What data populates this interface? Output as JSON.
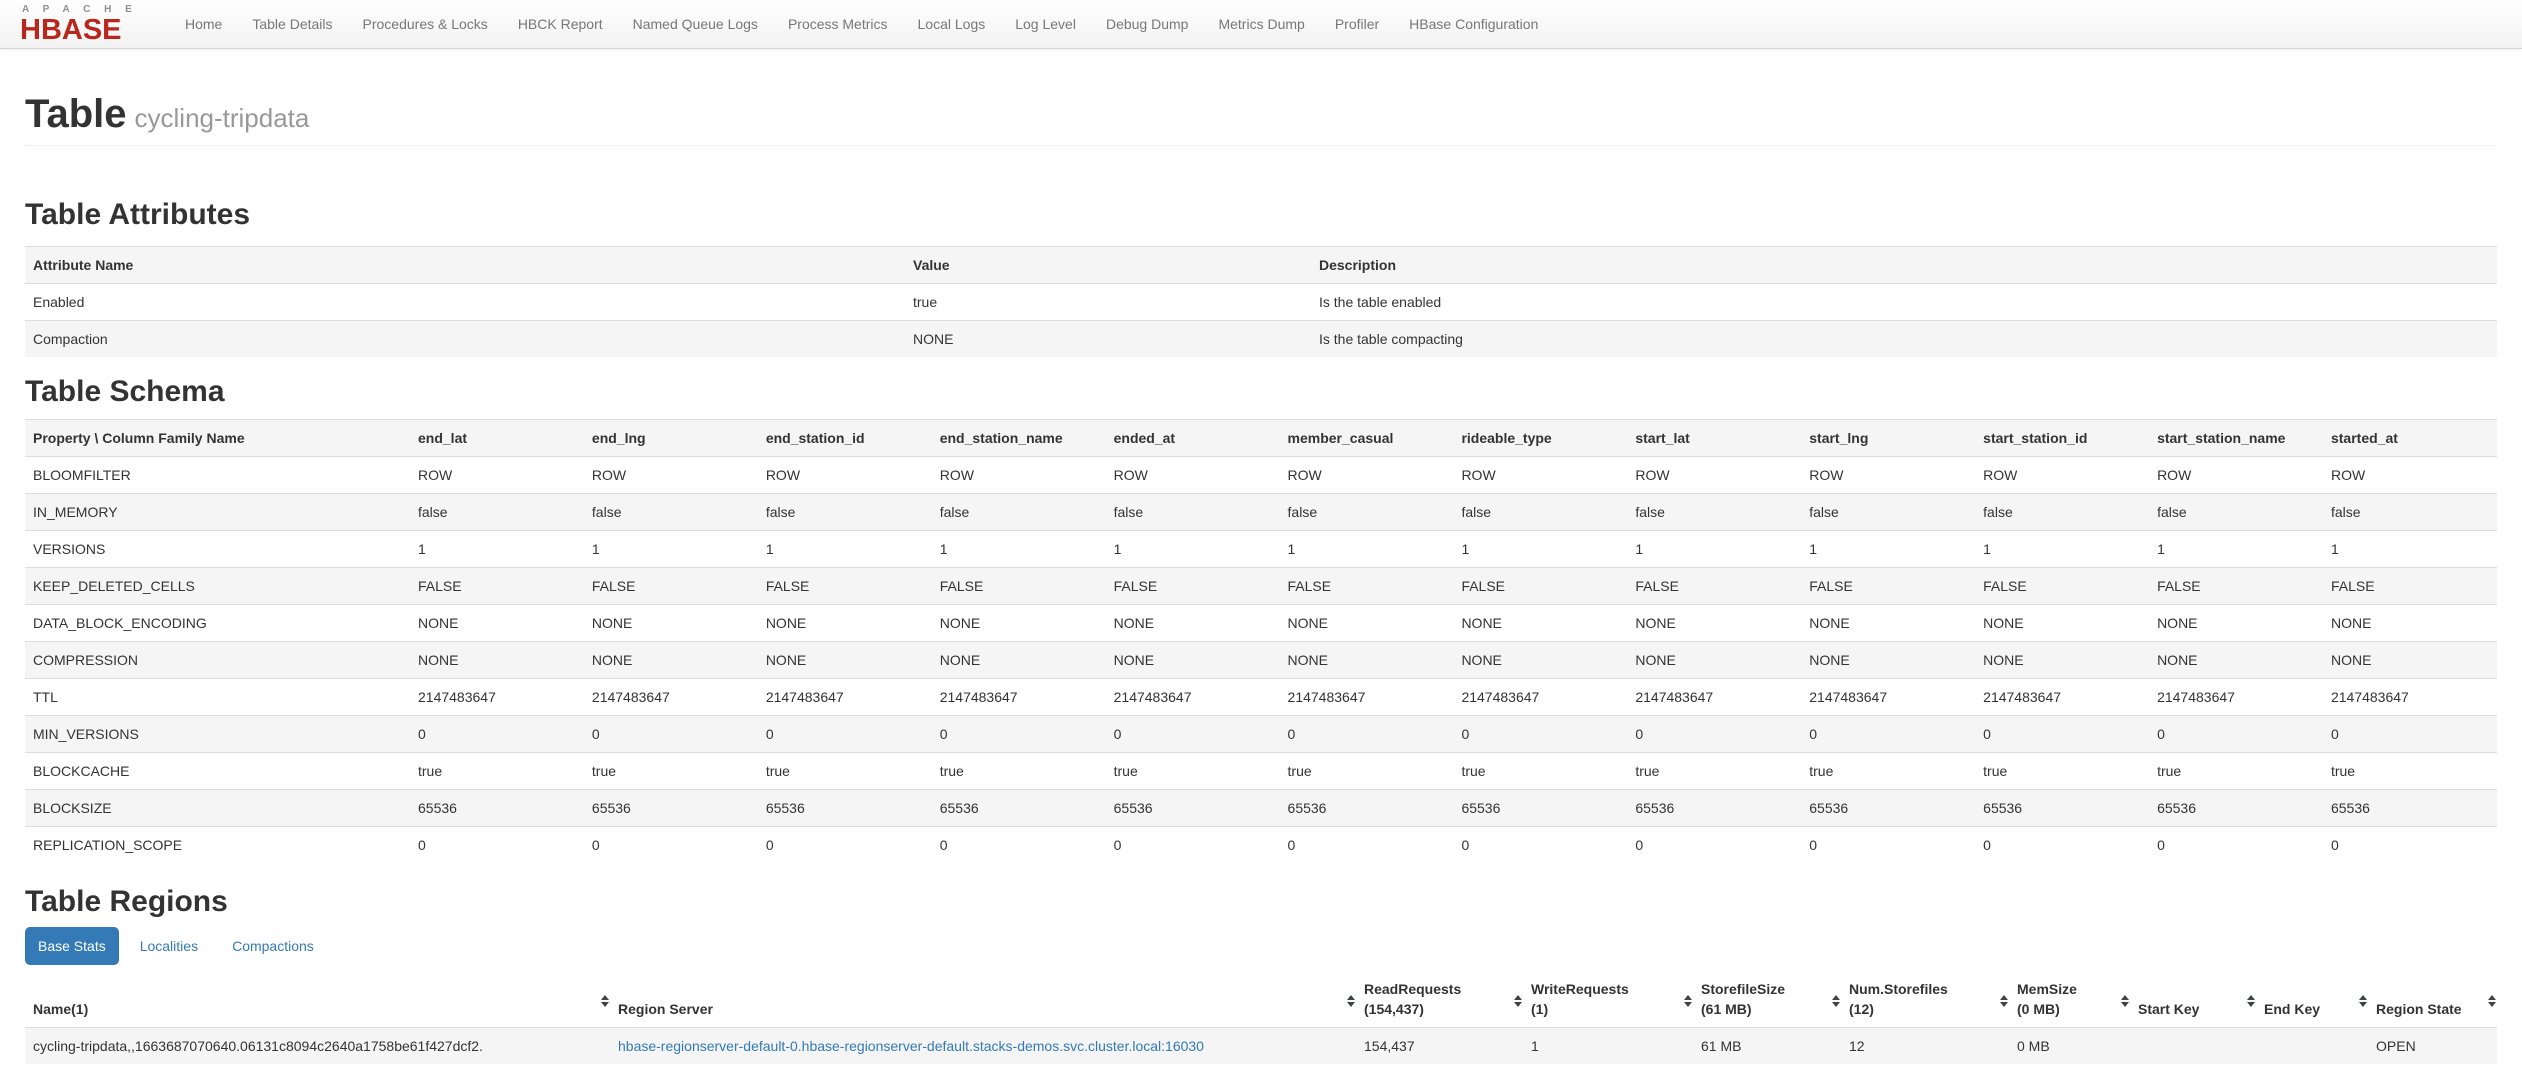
{
  "colors": {
    "accent_blue": "#337ab7",
    "brand_red": "#b9261c",
    "stripe": "#f5f5f5"
  },
  "nav": {
    "brand_top": "A P A C H E",
    "brand_bottom": "HBASE",
    "items": [
      "Home",
      "Table Details",
      "Procedures & Locks",
      "HBCK Report",
      "Named Queue Logs",
      "Process Metrics",
      "Local Logs",
      "Log Level",
      "Debug Dump",
      "Metrics Dump",
      "Profiler",
      "HBase Configuration"
    ]
  },
  "page": {
    "title": "Table",
    "subtitle": "cycling-tripdata"
  },
  "attributes": {
    "heading": "Table Attributes",
    "columns": [
      "Attribute Name",
      "Value",
      "Description"
    ],
    "rows": [
      [
        "Enabled",
        "true",
        "Is the table enabled"
      ],
      [
        "Compaction",
        "NONE",
        "Is the table compacting"
      ]
    ]
  },
  "schema": {
    "heading": "Table Schema",
    "corner_header": "Property \\ Column Family Name",
    "families": [
      "end_lat",
      "end_lng",
      "end_station_id",
      "end_station_name",
      "ended_at",
      "member_casual",
      "rideable_type",
      "start_lat",
      "start_lng",
      "start_station_id",
      "start_station_name",
      "started_at"
    ],
    "properties": [
      {
        "name": "BLOOMFILTER",
        "value": "ROW"
      },
      {
        "name": "IN_MEMORY",
        "value": "false"
      },
      {
        "name": "VERSIONS",
        "value": "1"
      },
      {
        "name": "KEEP_DELETED_CELLS",
        "value": "FALSE"
      },
      {
        "name": "DATA_BLOCK_ENCODING",
        "value": "NONE"
      },
      {
        "name": "COMPRESSION",
        "value": "NONE"
      },
      {
        "name": "TTL",
        "value": "2147483647"
      },
      {
        "name": "MIN_VERSIONS",
        "value": "0"
      },
      {
        "name": "BLOCKCACHE",
        "value": "true"
      },
      {
        "name": "BLOCKSIZE",
        "value": "65536"
      },
      {
        "name": "REPLICATION_SCOPE",
        "value": "0"
      }
    ]
  },
  "regions": {
    "heading": "Table Regions",
    "tabs": [
      {
        "label": "Base Stats",
        "active": true
      },
      {
        "label": "Localities",
        "active": false
      },
      {
        "label": "Compactions",
        "active": false
      }
    ],
    "sort_icon": "up-down-arrows",
    "columns": [
      {
        "key": "name",
        "label": "Name(1)",
        "sub": "",
        "sortable": true
      },
      {
        "key": "server",
        "label": "Region Server",
        "sub": "",
        "sortable": true
      },
      {
        "key": "read_requests",
        "label": "ReadRequests",
        "sub": "(154,437)",
        "sortable": true
      },
      {
        "key": "write_requests",
        "label": "WriteRequests",
        "sub": "(1)",
        "sortable": true
      },
      {
        "key": "storefile_size",
        "label": "StorefileSize",
        "sub": "(61 MB)",
        "sortable": true
      },
      {
        "key": "num_storefiles",
        "label": "Num.Storefiles",
        "sub": "(12)",
        "sortable": true
      },
      {
        "key": "mem_size",
        "label": "MemSize",
        "sub": "(0 MB)",
        "sortable": true
      },
      {
        "key": "start_key",
        "label": "Start Key",
        "sub": "",
        "sortable": true
      },
      {
        "key": "end_key",
        "label": "End Key",
        "sub": "",
        "sortable": true
      },
      {
        "key": "region_state",
        "label": "Region State",
        "sub": "",
        "sortable": true
      }
    ],
    "rows": [
      {
        "name": "cycling-tripdata,,1663687070640.06131c8094c2640a1758be61f427dcf2.",
        "server": "hbase-regionserver-default-0.hbase-regionserver-default.stacks-demos.svc.cluster.local:16030",
        "read_requests": "154,437",
        "write_requests": "1",
        "storefile_size": "61 MB",
        "num_storefiles": "12",
        "mem_size": "0 MB",
        "start_key": "",
        "end_key": "",
        "region_state": "OPEN"
      }
    ]
  }
}
